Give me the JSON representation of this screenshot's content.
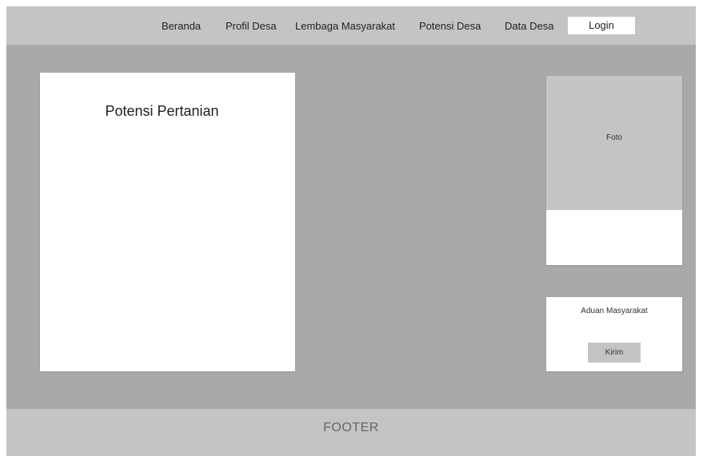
{
  "nav": {
    "items": [
      {
        "label": "Beranda"
      },
      {
        "label": "Profil Desa"
      },
      {
        "label": "Lembaga Masyarakat"
      },
      {
        "label": "Potensi Desa"
      },
      {
        "label": "Data Desa"
      }
    ],
    "login_label": "Login"
  },
  "main": {
    "title": "Potensi Pertanian"
  },
  "sidebar": {
    "photo_label": "Foto",
    "complaint_label": "Aduan Masyarakat",
    "submit_label": "Kirim"
  },
  "footer": {
    "text": "FOOTER"
  },
  "colors": {
    "page_background": "#a9a9a9",
    "bar_background": "#c4c4c4",
    "panel_background": "#ffffff"
  }
}
